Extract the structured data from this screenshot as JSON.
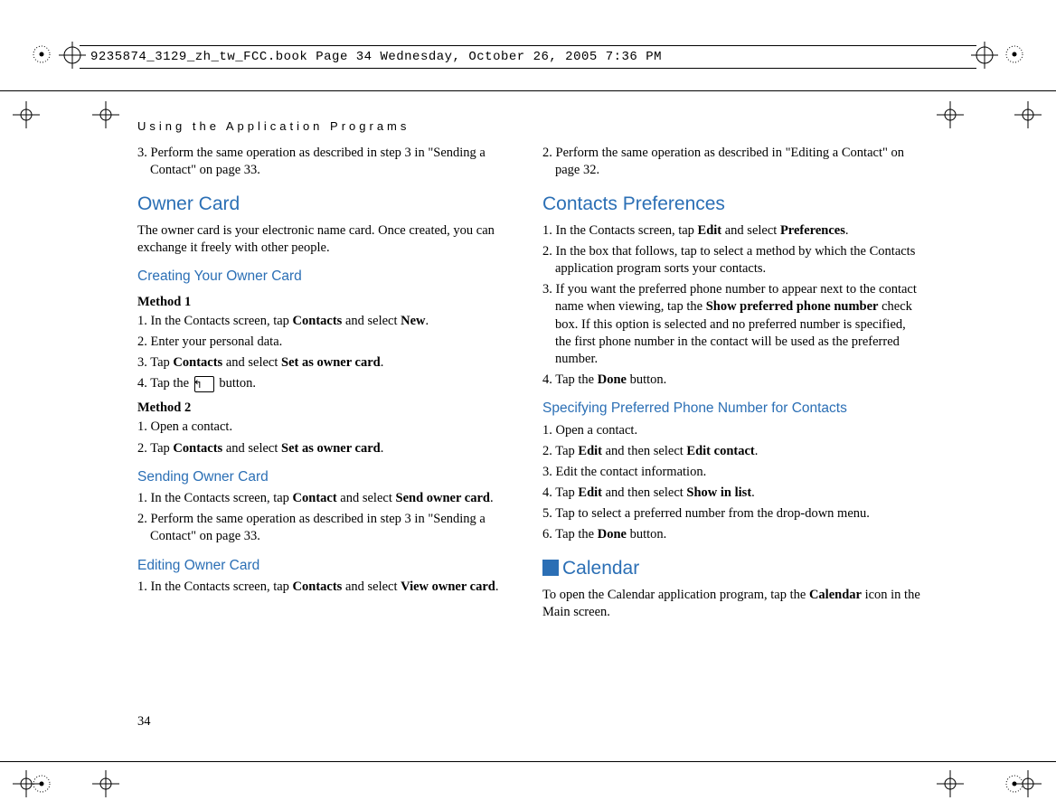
{
  "header": {
    "file_info": "9235874_3129_zh_tw_FCC.book  Page 34  Wednesday, October 26, 2005  7:36 PM"
  },
  "section_header": "Using the Application Programs",
  "page_number": "34",
  "col1": {
    "step3": "3. Perform the same operation as described in step 3 in \"Sending a Contact\" on page 33.",
    "owner_card_h": "Owner Card",
    "owner_card_p": "The owner card is your electronic name card. Once created, you can exchange it freely with other people.",
    "creating_h": "Creating Your Owner Card",
    "method1_h": "Method 1",
    "m1_1a": "1. In the Contacts screen, tap ",
    "m1_1b": "Contacts",
    "m1_1c": " and select ",
    "m1_1d": "New",
    "m1_1e": ".",
    "m1_2": "2. Enter your personal data.",
    "m1_3a": "3. Tap ",
    "m1_3b": "Contacts",
    "m1_3c": " and select ",
    "m1_3d": "Set as owner card",
    "m1_3e": ".",
    "m1_4a": "4. Tap the ",
    "m1_4b": " button.",
    "method2_h": "Method 2",
    "m2_1": "1. Open a contact.",
    "m2_2a": "2. Tap ",
    "m2_2b": "Contacts",
    "m2_2c": " and select ",
    "m2_2d": "Set as owner card",
    "m2_2e": ".",
    "sending_h": "Sending Owner Card",
    "s_1a": "1. In the Contacts screen, tap ",
    "s_1b": "Contact",
    "s_1c": " and select ",
    "s_1d": "Send owner card",
    "s_1e": ".",
    "s_2": "2. Perform the same operation as described in step 3 in \"Sending a Contact\" on page 33.",
    "editing_h": "Editing Owner Card",
    "e_1a": "1. In the Contacts screen, tap ",
    "e_1b": "Contacts",
    "e_1c": " and select ",
    "e_1d": "View owner card",
    "e_1e": "."
  },
  "col2": {
    "top2": "2. Perform the same operation as described in \"Editing a Contact\" on page 32.",
    "prefs_h": "Contacts Preferences",
    "p1a": "1. In the Contacts screen, tap ",
    "p1b": "Edit",
    "p1c": " and select ",
    "p1d": "Preferences",
    "p1e": ".",
    "p2": "2. In the box that follows, tap to select a method by which the Contacts application program sorts your contacts.",
    "p3a": "3. If you want the preferred phone number to appear next to the contact name when viewing, tap the ",
    "p3b": "Show preferred phone number",
    "p3c": " check box. If this option is selected and no preferred number is specified, the first phone number in the contact will be used as the preferred number.",
    "p4a": "4. Tap the ",
    "p4b": "Done",
    "p4c": " button.",
    "spn_h": "Specifying Preferred Phone Number for Contacts",
    "sp1": "1. Open a contact.",
    "sp2a": "2. Tap ",
    "sp2b": "Edit",
    "sp2c": " and then select ",
    "sp2d": "Edit contact",
    "sp2e": ".",
    "sp3": "3. Edit the contact information.",
    "sp4a": "4. Tap ",
    "sp4b": "Edit",
    "sp4c": " and then select ",
    "sp4d": "Show in list",
    "sp4e": ".",
    "sp5": "5. Tap to select a preferred number from the drop-down menu.",
    "sp6a": "6. Tap the ",
    "sp6b": "Done",
    "sp6c": " button.",
    "cal_h": "Calendar",
    "cal_pa": "To open the Calendar application program, tap the ",
    "cal_pb": "Calendar",
    "cal_pc": " icon in the Main screen."
  }
}
